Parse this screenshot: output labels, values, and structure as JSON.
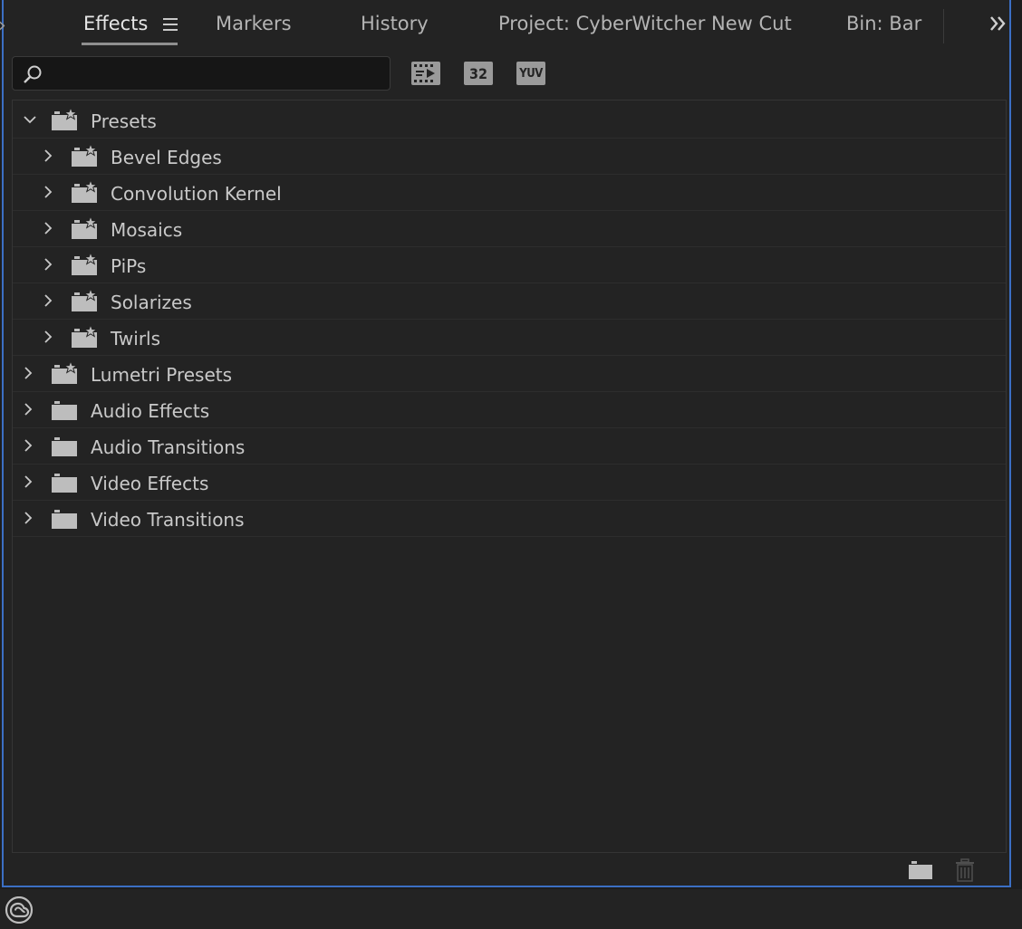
{
  "tabs": [
    {
      "label": "Effects",
      "active": true
    },
    {
      "label": "Markers",
      "active": false
    },
    {
      "label": "History",
      "active": false
    },
    {
      "label": "Project: CyberWitcher New Cut",
      "active": false
    },
    {
      "label": "Bin: Bar",
      "active": false
    }
  ],
  "search": {
    "value": "",
    "placeholder": ""
  },
  "filters": [
    {
      "icon": "accelerated-effects-icon",
      "label": ""
    },
    {
      "icon": "32-bit-color-icon",
      "label": "32"
    },
    {
      "icon": "yuv-effects-icon",
      "label": "YUV"
    }
  ],
  "tree": [
    {
      "label": "Presets",
      "level": 0,
      "expanded": true,
      "folder_type": "preset"
    },
    {
      "label": "Bevel Edges",
      "level": 1,
      "expanded": false,
      "folder_type": "preset"
    },
    {
      "label": "Convolution Kernel",
      "level": 1,
      "expanded": false,
      "folder_type": "preset"
    },
    {
      "label": "Mosaics",
      "level": 1,
      "expanded": false,
      "folder_type": "preset"
    },
    {
      "label": "PiPs",
      "level": 1,
      "expanded": false,
      "folder_type": "preset"
    },
    {
      "label": "Solarizes",
      "level": 1,
      "expanded": false,
      "folder_type": "preset"
    },
    {
      "label": "Twirls",
      "level": 1,
      "expanded": false,
      "folder_type": "preset"
    },
    {
      "label": "Lumetri Presets",
      "level": 0,
      "expanded": false,
      "folder_type": "preset"
    },
    {
      "label": "Audio Effects",
      "level": 0,
      "expanded": false,
      "folder_type": "plain"
    },
    {
      "label": "Audio Transitions",
      "level": 0,
      "expanded": false,
      "folder_type": "plain"
    },
    {
      "label": "Video Effects",
      "level": 0,
      "expanded": false,
      "folder_type": "plain"
    },
    {
      "label": "Video Transitions",
      "level": 0,
      "expanded": false,
      "folder_type": "plain"
    }
  ],
  "bottom_bar": {
    "new_bin_icon": "new-bin-icon",
    "delete_icon": "trash-icon"
  },
  "colors": {
    "focus_border": "#3b6fc4",
    "panel_bg": "#232323",
    "text": "#c9c9c9"
  }
}
